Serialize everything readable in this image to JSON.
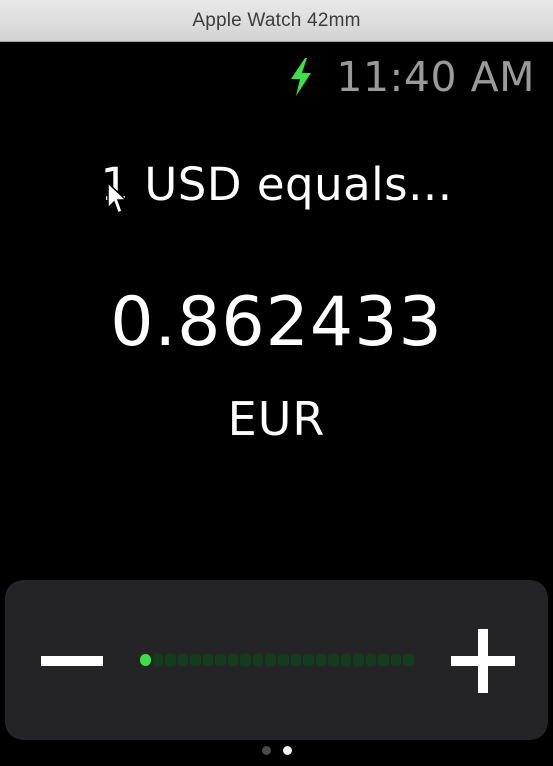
{
  "window": {
    "title": "Apple Watch 42mm"
  },
  "status": {
    "time": "11:40 AM",
    "icon": "charging-bolt-icon",
    "icon_color": "#3ee04a"
  },
  "converter": {
    "headline": "1 USD equals...",
    "value": "0.862433",
    "currency": "EUR"
  },
  "stepper": {
    "decrement_icon": "minus-icon",
    "increment_icon": "plus-icon",
    "level": 0.0,
    "accent_color": "#3ee04a"
  },
  "pager": {
    "pages": 2,
    "current": 2
  }
}
